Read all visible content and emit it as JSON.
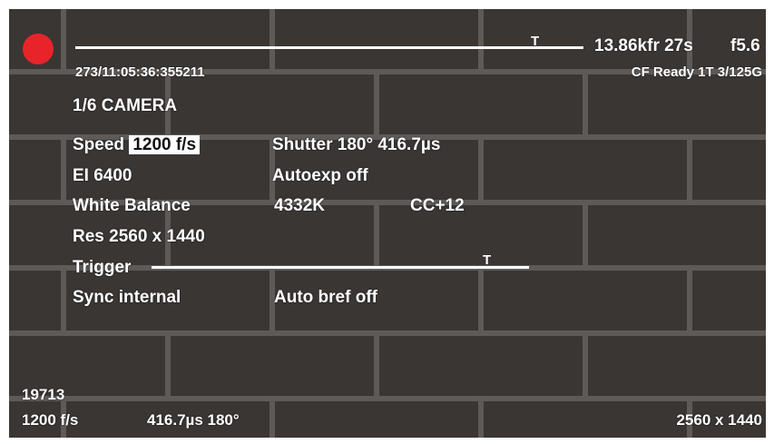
{
  "status": {
    "frames_time": "13.86kfr 27s",
    "aperture": "f5.6",
    "timecode": "273/11:05:36:355211",
    "media": "CF Ready 1T 3/125G"
  },
  "camera": {
    "title": "1/6 CAMERA",
    "speed_label": "Speed",
    "speed_value": "1200 f/s",
    "shutter": "Shutter 180° 416.7µs",
    "ei": "EI 6400",
    "autoexp": "Autoexp off",
    "wb_label": "White Balance",
    "wb_temp": "4332K",
    "wb_cc": "CC+12",
    "res": "Res  2560 x 1440",
    "trigger": "Trigger",
    "sync": "Sync internal",
    "autobref": "Auto bref off"
  },
  "markers": {
    "top": "T",
    "trigger": "T"
  },
  "progress": {
    "recording_marker_fraction": 0.9,
    "trigger_marker_fraction": 0.88
  },
  "footer": {
    "frame_count": "19713",
    "fps": "1200 f/s",
    "shutter": "416.7µs 180°",
    "resolution": "2560 x 1440"
  },
  "colors": {
    "record": "#e8242a",
    "overlay_text": "#ffffff",
    "highlight_bg": "#ffffff"
  },
  "icons": {
    "record": "record-dot-icon"
  }
}
